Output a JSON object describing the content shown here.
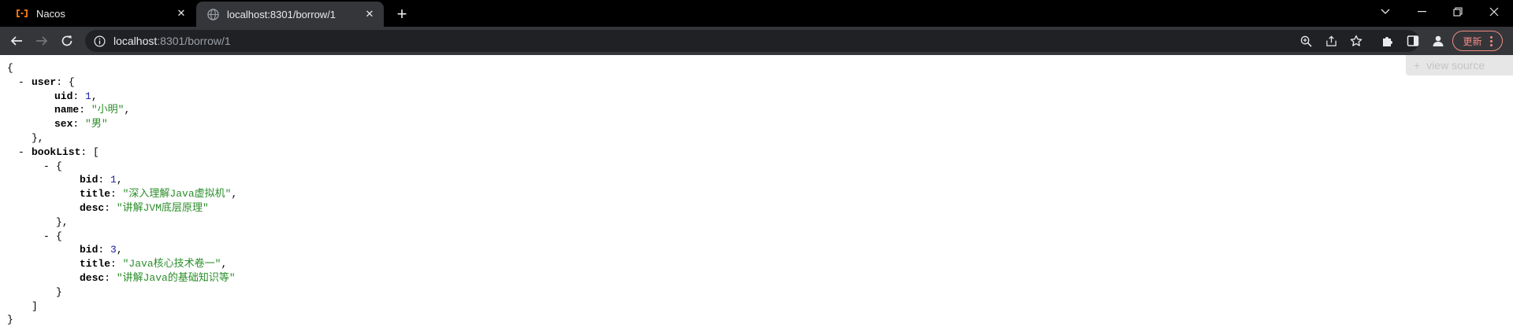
{
  "tabs": [
    {
      "title": "Nacos",
      "active": false,
      "favicon": "nacos-logo-icon"
    },
    {
      "title": "localhost:8301/borrow/1",
      "active": true,
      "favicon": "globe-icon"
    }
  ],
  "omnibox": {
    "host": "localhost",
    "rest": ":8301/borrow/1"
  },
  "toolbar": {
    "update_label": "更新"
  },
  "viewer": {
    "view_source_label": "view source"
  },
  "json": {
    "open_brace": "{",
    "close_brace": "}",
    "user_key": "user",
    "bookList_key": "bookList",
    "user": {
      "uid_key": "uid",
      "uid": "1",
      "name_key": "name",
      "name": "\"小明\"",
      "sex_key": "sex",
      "sex": "\"男\""
    },
    "books": [
      {
        "bid_key": "bid",
        "bid": "1",
        "title_key": "title",
        "title": "\"深入理解Java虚拟机\"",
        "desc_key": "desc",
        "desc": "\"讲解JVM底层原理\""
      },
      {
        "bid_key": "bid",
        "bid": "3",
        "title_key": "title",
        "title": "\"Java核心技术卷一\"",
        "desc_key": "desc",
        "desc": "\"讲解Java的基础知识等\""
      }
    ]
  },
  "colors": {
    "tab_strip": "#000000",
    "toolbar": "#35363a",
    "omnibox": "#202124",
    "json_number": "#1a1aa6",
    "json_string": "#2a8d2a",
    "update": "#f28b82"
  }
}
